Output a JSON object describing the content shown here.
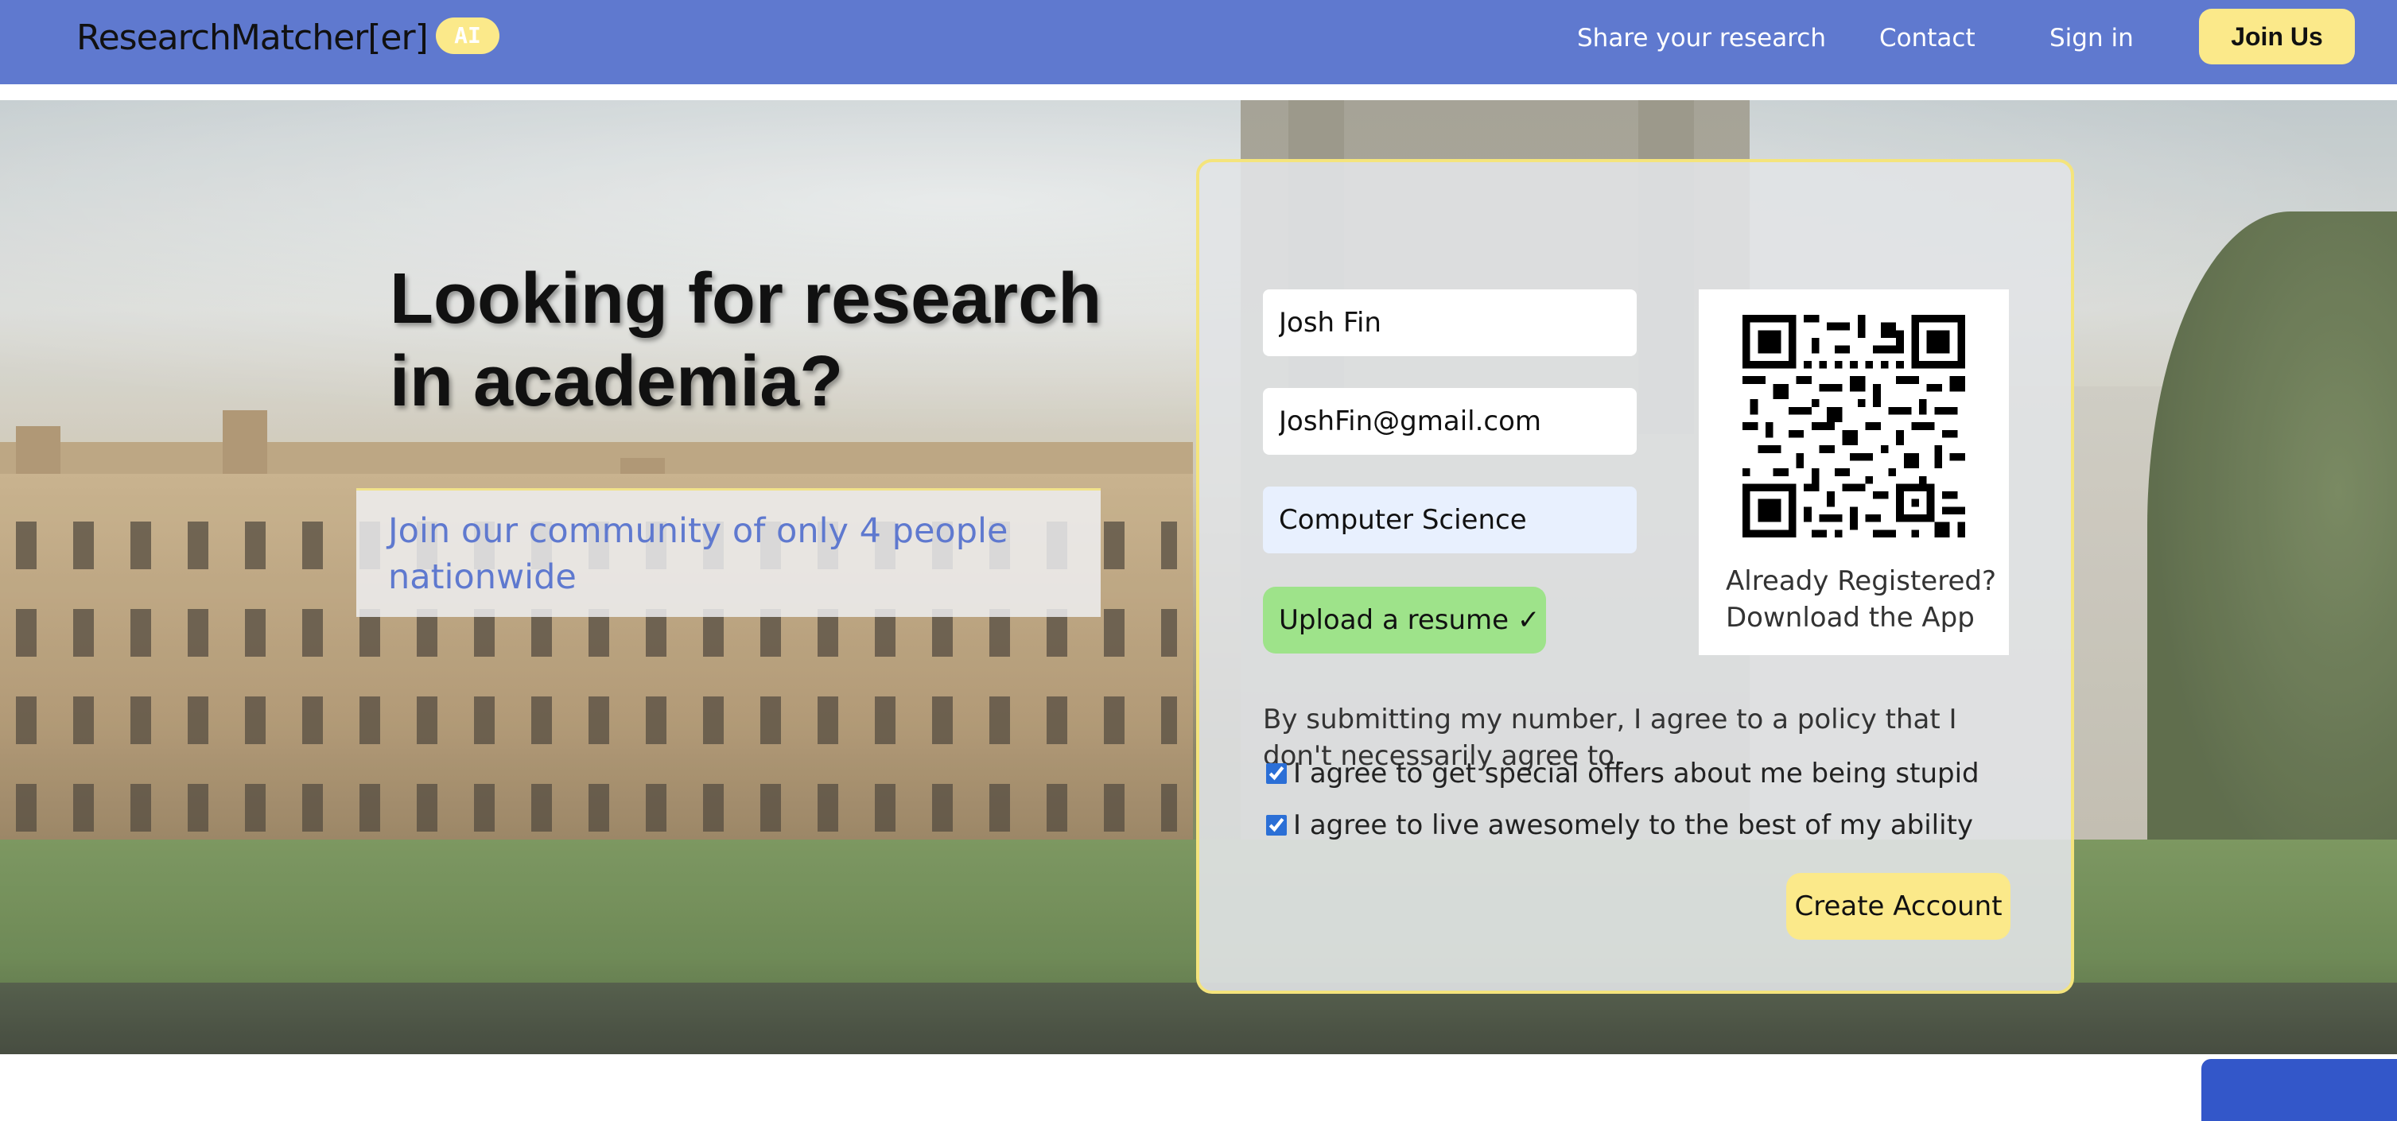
{
  "navbar": {
    "brand": "ResearchMatcher[er]",
    "badge": "AI",
    "links": [
      "Share your research",
      "Contact",
      "Sign in"
    ],
    "join_label": "Join Us"
  },
  "hero": {
    "headline": "Looking for research in academia?",
    "tagline": "Join our community of only 4 people nationwide"
  },
  "form": {
    "name_value": "Josh Fin",
    "email_value": "JoshFin@gmail.com",
    "major_value": "Computer Science",
    "upload_label": "Upload a resume ✓",
    "qr_caption": "Already Registered? Download the App",
    "disclaimer": "By submitting my number, I agree to a policy that I don't necessarily agree to.",
    "checkbox_1": "I agree to get special offers about me being stupid",
    "checkbox_2": "I agree to live awesomely to the best of my ability",
    "create_label": "Create Account"
  },
  "colors": {
    "navbar": "#5f79cf",
    "accent_yellow": "#fbe98a",
    "upload_green": "#9ee38a",
    "bottom_blue": "#3357c9"
  }
}
